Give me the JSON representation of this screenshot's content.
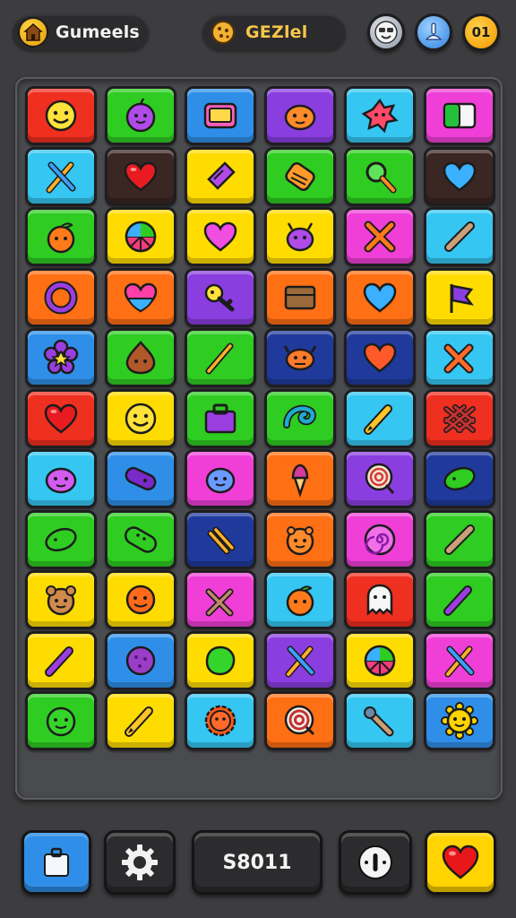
{
  "header": {
    "left_pill_label": "Gumeels",
    "left_badge_icon": "cookie-house-icon",
    "mid_pill_label": "GEZlel",
    "mid_badge_icon": "cookie-icon",
    "avatar_icon": "face-avatar-icon",
    "blue_button_icon": "plunger-icon",
    "orange_button_label": "01"
  },
  "palette": {
    "red": "#ef2f1f",
    "green": "#2fcc22",
    "blue": "#2f8fe8",
    "purple": "#8a3ee0",
    "cyan": "#35c6f2",
    "magenta": "#ef3fd7",
    "dark": "#3a2622",
    "yellow": "#ffdc00",
    "orange": "#ff6f14",
    "navy": "#203a9c"
  },
  "board": {
    "rows": [
      [
        [
          "red",
          "smiley"
        ],
        [
          "green",
          "purple-fruit"
        ],
        [
          "blue",
          "tv"
        ],
        [
          "purple",
          "orange-critter"
        ],
        [
          "cyan",
          "splat"
        ],
        [
          "magenta",
          "card"
        ]
      ],
      [
        [
          "cyan",
          "crossed-tools"
        ],
        [
          "dark",
          "heart"
        ],
        [
          "yellow",
          "candy"
        ],
        [
          "green",
          "scroll"
        ],
        [
          "green",
          "magnifier"
        ],
        [
          "dark",
          "blue-heart"
        ]
      ],
      [
        [
          "green",
          "orange-fruit"
        ],
        [
          "yellow",
          "wheel"
        ],
        [
          "yellow",
          "pink-heart"
        ],
        [
          "yellow",
          "bug"
        ],
        [
          "magenta",
          "cross"
        ],
        [
          "cyan",
          "baton"
        ]
      ],
      [
        [
          "orange",
          "ring"
        ],
        [
          "orange",
          "bowl-heart"
        ],
        [
          "purple",
          "key"
        ],
        [
          "orange",
          "box"
        ],
        [
          "orange",
          "blue-heart"
        ],
        [
          "yellow",
          "flag"
        ]
      ],
      [
        [
          "blue",
          "flower"
        ],
        [
          "green",
          "blob"
        ],
        [
          "green",
          "brush"
        ],
        [
          "navy",
          "crab"
        ],
        [
          "navy",
          "orange-heart"
        ],
        [
          "cyan",
          "hammers"
        ]
      ],
      [
        [
          "red",
          "heart"
        ],
        [
          "yellow",
          "smiley"
        ],
        [
          "green",
          "bag"
        ],
        [
          "green",
          "swirl-wave"
        ],
        [
          "cyan",
          "pencil"
        ],
        [
          "red",
          "lattice"
        ]
      ],
      [
        [
          "cyan",
          "pig"
        ],
        [
          "blue",
          "capsule"
        ],
        [
          "magenta",
          "creature"
        ],
        [
          "orange",
          "ice-cream"
        ],
        [
          "purple",
          "lollipop"
        ],
        [
          "navy",
          "pickle"
        ]
      ],
      [
        [
          "green",
          "pickle"
        ],
        [
          "green",
          "cucumber"
        ],
        [
          "navy",
          "stripes"
        ],
        [
          "orange",
          "critter"
        ],
        [
          "magenta",
          "swirl"
        ],
        [
          "green",
          "baton"
        ]
      ],
      [
        [
          "yellow",
          "bear"
        ],
        [
          "yellow",
          "orange-face"
        ],
        [
          "magenta",
          "scissors"
        ],
        [
          "cyan",
          "orange-fruit"
        ],
        [
          "red",
          "ghost"
        ],
        [
          "green",
          "purple-pencil"
        ]
      ],
      [
        [
          "yellow",
          "purple-pencil"
        ],
        [
          "blue",
          "cookie"
        ],
        [
          "yellow",
          "green-blob"
        ],
        [
          "purple",
          "crossed-tools"
        ],
        [
          "yellow",
          "wheel"
        ],
        [
          "magenta",
          "crossed-tools"
        ]
      ],
      [
        [
          "green",
          "green-face"
        ],
        [
          "yellow",
          "pencil"
        ],
        [
          "cyan",
          "sun-flower"
        ],
        [
          "orange",
          "target"
        ],
        [
          "cyan",
          "wrench"
        ],
        [
          "blue",
          "sun"
        ]
      ]
    ]
  },
  "footer": {
    "shop_icon": "bag-icon",
    "settings_icon": "gear-icon",
    "score_text": "S8011",
    "timer_icon": "clock-icon",
    "favorite_icon": "heart-icon"
  }
}
